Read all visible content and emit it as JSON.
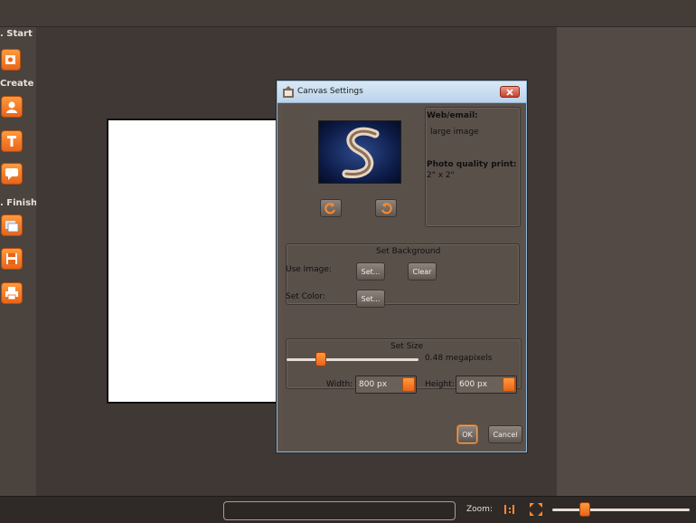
{
  "toolbar": {
    "sections": {
      "start": ". Start",
      "create": "Create",
      "finish": ". Finish"
    }
  },
  "dialog": {
    "title": "Canvas Settings",
    "info": {
      "web_heading": "Web/email:",
      "web_value": "large image",
      "print_heading": "Photo quality print:",
      "print_value": "2\" x 2\""
    },
    "background": {
      "title": "Set Background",
      "use_image_label": "Use Image:",
      "set_image_button": "Set...",
      "clear_button": "Clear",
      "set_color_label": "Set Color:",
      "set_color_button": "Set..."
    },
    "size": {
      "title": "Set Size",
      "megapixels_text": "0.48 megapixels",
      "megapixel_fraction": 0.26,
      "width_label": "Width:",
      "width_value": "800 px",
      "height_label": "Height:",
      "height_value": "600 px"
    },
    "ok_button": "OK",
    "cancel_button": "Cancel"
  },
  "bottombar": {
    "zoom_label": "Zoom:",
    "zoom_fraction": 0.24
  },
  "colors": {
    "accent": "#e8641a",
    "background": "#3f3834",
    "dialog": "#5c524c"
  }
}
